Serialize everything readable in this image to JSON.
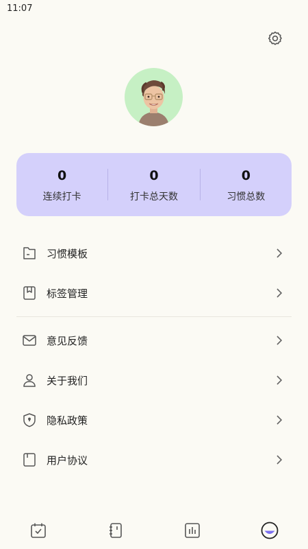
{
  "status_bar": {
    "time": "11:07"
  },
  "header": {
    "settings_icon": "gear-icon"
  },
  "profile": {
    "avatar": "memoji-avatar",
    "avatar_bg": "#c6f0c4"
  },
  "stats": {
    "card_color": "#d4d0fb",
    "items": [
      {
        "value": "0",
        "label": "连续打卡"
      },
      {
        "value": "0",
        "label": "打卡总天数"
      },
      {
        "value": "0",
        "label": "习惯总数"
      }
    ]
  },
  "menu": {
    "group1": [
      {
        "label": "习惯模板",
        "icon": "folder-icon"
      },
      {
        "label": "标签管理",
        "icon": "bookmark-tag-icon"
      }
    ],
    "group2": [
      {
        "label": "意见反馈",
        "icon": "mail-icon"
      },
      {
        "label": "关于我们",
        "icon": "user-icon"
      },
      {
        "label": "隐私政策",
        "icon": "shield-icon"
      },
      {
        "label": "用户协议",
        "icon": "document-icon"
      }
    ]
  },
  "tab_bar": {
    "active_color": "#7b6ff0",
    "tabs": [
      {
        "icon": "calendar-check-icon",
        "active": false
      },
      {
        "icon": "notebook-icon",
        "active": false
      },
      {
        "icon": "bar-chart-icon",
        "active": false
      },
      {
        "icon": "smile-profile-icon",
        "active": true
      }
    ]
  }
}
